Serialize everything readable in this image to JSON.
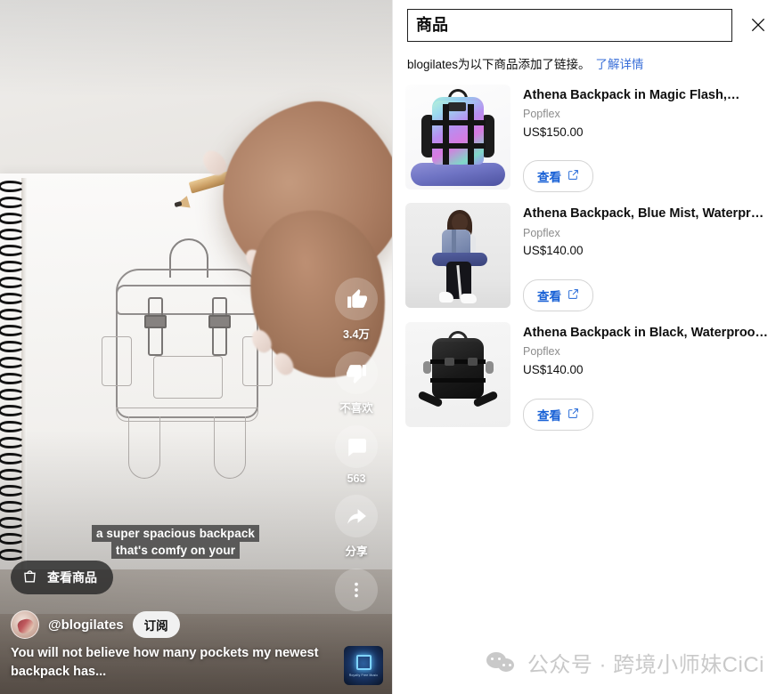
{
  "player": {
    "caption_lines": [
      "a super spacious backpack",
      "that's comfy on your"
    ],
    "shop_pill_label": "查看商品",
    "shop_pill_icon": "shopping-bag-icon",
    "channel_handle": "@blogilates",
    "subscribe_label": "订阅",
    "video_title": "You will not believe how many pockets my newest backpack has...",
    "music_thumb_label": "Royalty Free Music",
    "actions": [
      {
        "icon": "thumbs-up-icon",
        "label": "3.4万"
      },
      {
        "icon": "thumbs-down-icon",
        "label": "不喜欢"
      },
      {
        "icon": "comment-icon",
        "label": "563"
      },
      {
        "icon": "share-icon",
        "label": "分享"
      }
    ],
    "more_icon": "more-vertical-icon"
  },
  "panel": {
    "title": "商品",
    "close_icon": "close-icon",
    "note_text": "blogilates为以下商品添加了链接。",
    "note_link": "了解详情",
    "products": [
      {
        "name": "Athena Backpack in Magic Flash,…",
        "brand": "Popflex",
        "price": "US$150.00",
        "button_label": "查看",
        "button_icon": "external-link-icon",
        "thumb": "magic-flash-backpack"
      },
      {
        "name": "Athena Backpack, Blue Mist, Waterproof…",
        "brand": "Popflex",
        "price": "US$140.00",
        "button_label": "查看",
        "button_icon": "external-link-icon",
        "thumb": "blue-mist-backpack-model"
      },
      {
        "name": "Athena Backpack in Black, Waterproof…",
        "brand": "Popflex",
        "price": "US$140.00",
        "button_label": "查看",
        "button_icon": "external-link-icon",
        "thumb": "black-backpack"
      }
    ]
  },
  "watermark": {
    "icon": "wechat-icon",
    "text": "公众号 · 跨境小师妹CiCi"
  },
  "colors": {
    "link_blue": "#3a6fd8",
    "button_blue": "#1a62d6",
    "text_primary": "#0f0f0f",
    "text_muted": "#8c8c8c",
    "watermark_grey": "#c9c9c9"
  }
}
